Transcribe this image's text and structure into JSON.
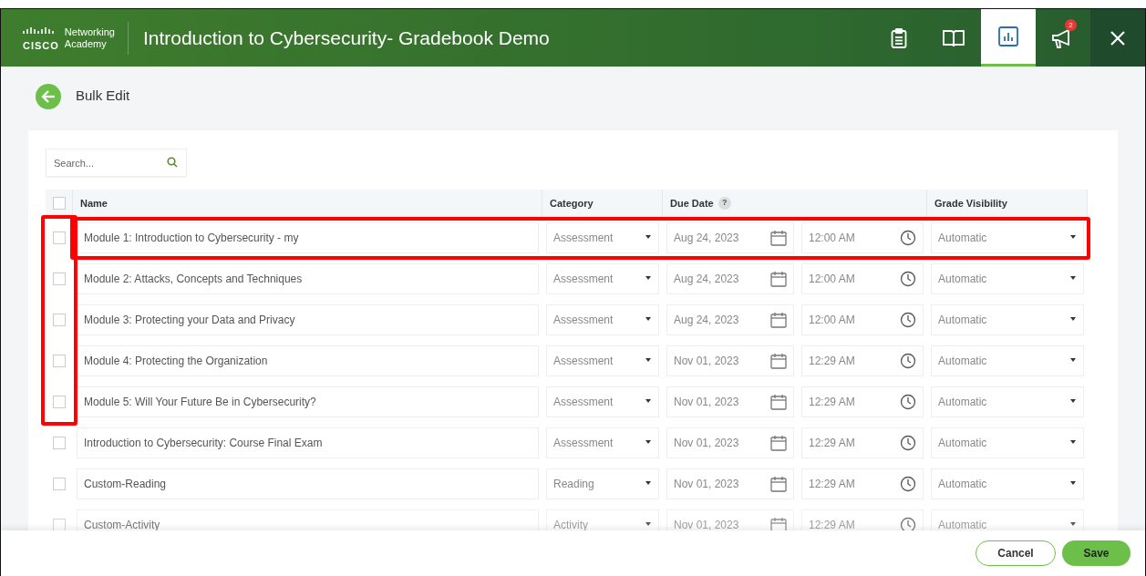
{
  "header": {
    "logo_top": "Networking",
    "logo_brand": "CISCO",
    "logo_bottom": "Academy",
    "title": "Introduction to Cybersecurity- Gradebook Demo",
    "tools": [
      {
        "kind": "clipboard",
        "selected": false
      },
      {
        "kind": "book",
        "selected": false
      },
      {
        "kind": "chart",
        "selected": true
      },
      {
        "kind": "megaphone",
        "selected": false,
        "badge": "2"
      },
      {
        "kind": "close",
        "selected": false
      }
    ]
  },
  "page": {
    "title": "Bulk Edit"
  },
  "search": {
    "placeholder": "Search..."
  },
  "table": {
    "select_all_checked": false,
    "columns": [
      "Name",
      "Category",
      "Due Date",
      "Grade Visibility"
    ],
    "help": "?",
    "rows": [
      {
        "checked": false,
        "name": "Module 1: Introduction to Cybersecurity - my",
        "category": "Assessment",
        "date": "Aug 24, 2023",
        "time": "12:00 AM",
        "visibility": "Automatic",
        "row_outlined": true,
        "checkbox_outlined": true
      },
      {
        "checked": false,
        "name": "Module 2: Attacks, Concepts and Techniques",
        "category": "Assessment",
        "date": "Aug 24, 2023",
        "time": "12:00 AM",
        "visibility": "Automatic",
        "row_outlined": false,
        "checkbox_outlined": true
      },
      {
        "checked": false,
        "name": "Module 3: Protecting your Data and Privacy",
        "category": "Assessment",
        "date": "Aug 24, 2023",
        "time": "12:00 AM",
        "visibility": "Automatic",
        "row_outlined": false,
        "checkbox_outlined": true
      },
      {
        "checked": false,
        "name": "Module 4: Protecting the Organization",
        "category": "Assessment",
        "date": "Nov 01, 2023",
        "time": "12:29 AM",
        "visibility": "Automatic",
        "row_outlined": false,
        "checkbox_outlined": true
      },
      {
        "checked": false,
        "name": "Module 5: Will Your Future Be in Cybersecurity?",
        "category": "Assessment",
        "date": "Nov 01, 2023",
        "time": "12:29 AM",
        "visibility": "Automatic",
        "row_outlined": false,
        "checkbox_outlined": true
      },
      {
        "checked": false,
        "name": "Introduction to Cybersecurity: Course Final Exam",
        "category": "Assessment",
        "date": "Nov 01, 2023",
        "time": "12:29 AM",
        "visibility": "Automatic",
        "row_outlined": false,
        "checkbox_outlined": false
      },
      {
        "checked": false,
        "name": "Custom-Reading",
        "category": "Reading",
        "date": "Nov 01, 2023",
        "time": "12:29 AM",
        "visibility": "Automatic",
        "row_outlined": false,
        "checkbox_outlined": false
      },
      {
        "checked": false,
        "name": "Custom-Activity",
        "category": "Activity",
        "date": "Nov 01, 2023",
        "time": "12:29 AM",
        "visibility": "Automatic",
        "row_outlined": false,
        "checkbox_outlined": false
      }
    ]
  },
  "footer": {
    "buttons": [
      {
        "label": "Cancel",
        "kind": "secondary"
      },
      {
        "label": "Save",
        "kind": "primary"
      }
    ]
  }
}
